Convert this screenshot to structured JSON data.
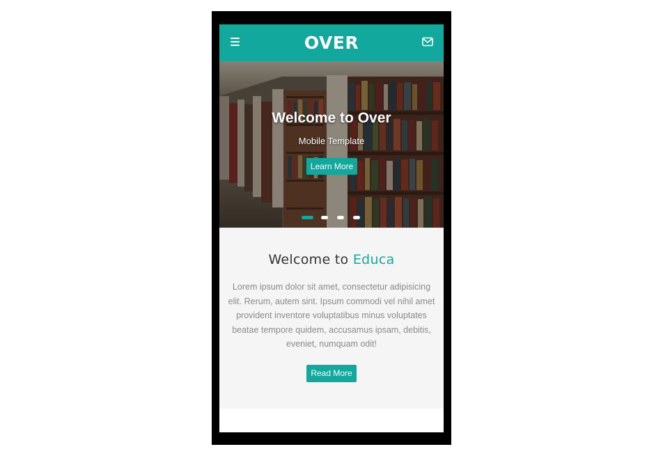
{
  "header": {
    "brand": "OVER",
    "menu_icon": "hamburger-menu-icon",
    "mail_icon": "envelope-icon"
  },
  "hero": {
    "title": "Welcome to Over",
    "subtitle": "Mobile Template",
    "button_label": "Learn More",
    "image": "library-bookshelves-photo",
    "slides": [
      {
        "active": true
      },
      {
        "active": false
      },
      {
        "active": false
      },
      {
        "active": false
      }
    ]
  },
  "welcome": {
    "title_prefix": "Welcome to",
    "title_accent": "Educa",
    "body": "Lorem ipsum dolor sit amet, consectetur adipisicing elit. Rerum, autem sint. Ipsum commodi vel nihil amet provident inventore voluptatibus minus voluptates beatae tempore quidem, accusamus ipsam, debitis, eveniet, numquam odit!",
    "button_label": "Read More"
  },
  "colors": {
    "accent": "#13a89e",
    "frame": "#000000",
    "content_bg": "#f5f5f5",
    "body_text": "#8a8a8a"
  }
}
